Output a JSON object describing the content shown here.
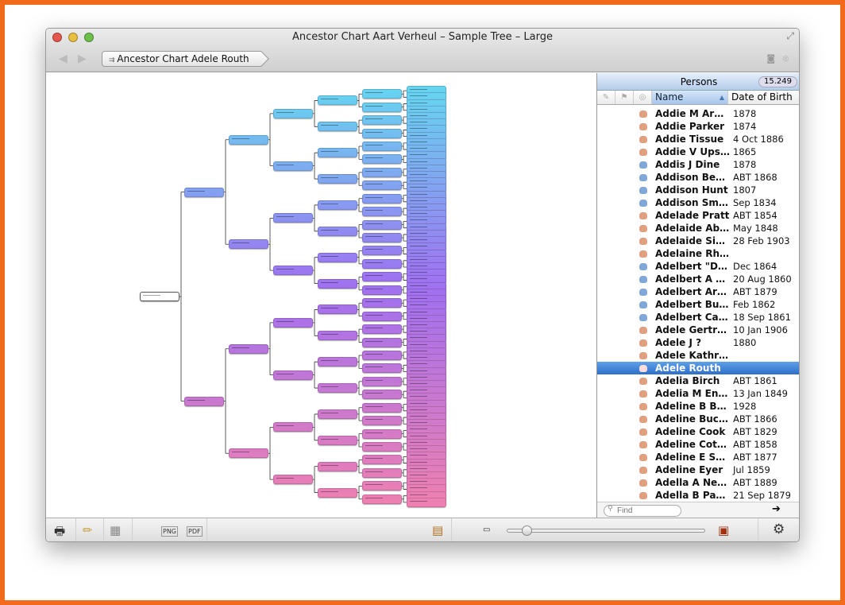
{
  "window": {
    "title": "Ancestor Chart Aart Verheul – Sample Tree – Large",
    "breadcrumb": "Ancestor Chart Adele Routh"
  },
  "panel": {
    "title": "Persons",
    "count": "15.249",
    "columns": {
      "name": "Name",
      "dob": "Date of Birth"
    },
    "persons": [
      {
        "name": "Addie M Arnold",
        "dob": "1878",
        "sex": "f"
      },
      {
        "name": "Addie Parker",
        "dob": "1874",
        "sex": "f"
      },
      {
        "name": "Addie Tissue",
        "dob": "4 Oct 1886",
        "sex": "f"
      },
      {
        "name": "Addie V Upson",
        "dob": "1865",
        "sex": "f"
      },
      {
        "name": "Addis J Dine",
        "dob": "1878",
        "sex": "m"
      },
      {
        "name": "Addison Beam",
        "dob": "ABT 1868",
        "sex": "m"
      },
      {
        "name": "Addison Hunt",
        "dob": "1807",
        "sex": "m"
      },
      {
        "name": "Addison Smith",
        "dob": "Sep 1834",
        "sex": "m"
      },
      {
        "name": "Adelade Pratt",
        "dob": "ABT 1854",
        "sex": "f"
      },
      {
        "name": "Adelaide Abell",
        "dob": "May 1848",
        "sex": "f"
      },
      {
        "name": "Adelaide Sim…",
        "dob": "28 Feb 1903",
        "sex": "f"
      },
      {
        "name": "Adelaine Rho…",
        "dob": "",
        "sex": "f"
      },
      {
        "name": "Adelbert \"Del…",
        "dob": "Dec 1864",
        "sex": "m"
      },
      {
        "name": "Adelbert A K…",
        "dob": "20 Aug 1860",
        "sex": "m"
      },
      {
        "name": "Adelbert Arnold",
        "dob": "ABT 1879",
        "sex": "m"
      },
      {
        "name": "Adelbert Buc…",
        "dob": "Feb 1862",
        "sex": "m"
      },
      {
        "name": "Adelbert Car…",
        "dob": "18 Sep 1861",
        "sex": "m"
      },
      {
        "name": "Adele Gertru…",
        "dob": "10 Jan 1906",
        "sex": "f"
      },
      {
        "name": "Adele J ?",
        "dob": "1880",
        "sex": "f"
      },
      {
        "name": "Adele Kathry…",
        "dob": "",
        "sex": "f"
      },
      {
        "name": "Adele Routh",
        "dob": "",
        "sex": "f",
        "selected": true
      },
      {
        "name": "Adelia Birch",
        "dob": "ABT 1861",
        "sex": "f"
      },
      {
        "name": "Adelia M Ensign",
        "dob": "13 Jan 1849",
        "sex": "f"
      },
      {
        "name": "Adeline B Berry",
        "dob": "1928",
        "sex": "f"
      },
      {
        "name": "Adeline Buch…",
        "dob": "ABT 1866",
        "sex": "f"
      },
      {
        "name": "Adeline Cook",
        "dob": "ABT 1829",
        "sex": "f"
      },
      {
        "name": "Adeline Cotton",
        "dob": "ABT 1858",
        "sex": "f"
      },
      {
        "name": "Adeline E Sm…",
        "dob": "ABT 1877",
        "sex": "f"
      },
      {
        "name": "Adeline Eyer",
        "dob": "Jul 1859",
        "sex": "f"
      },
      {
        "name": "Adella A Nelson",
        "dob": "ABT 1889",
        "sex": "f"
      },
      {
        "name": "Adella B Parks",
        "dob": "21 Sep 1879",
        "sex": "f"
      }
    ],
    "find_placeholder": "Find"
  },
  "toolbar": {
    "png": "PNG",
    "pdf": "PDF",
    "zoom_level": 0.1
  },
  "colors": {
    "male": "#7fa8d8",
    "female": "#e0a080",
    "selection": "#3a7bd5",
    "chart_top": "#5fe0f0",
    "chart_mid": "#a070f0",
    "chart_bottom": "#f080b0"
  }
}
